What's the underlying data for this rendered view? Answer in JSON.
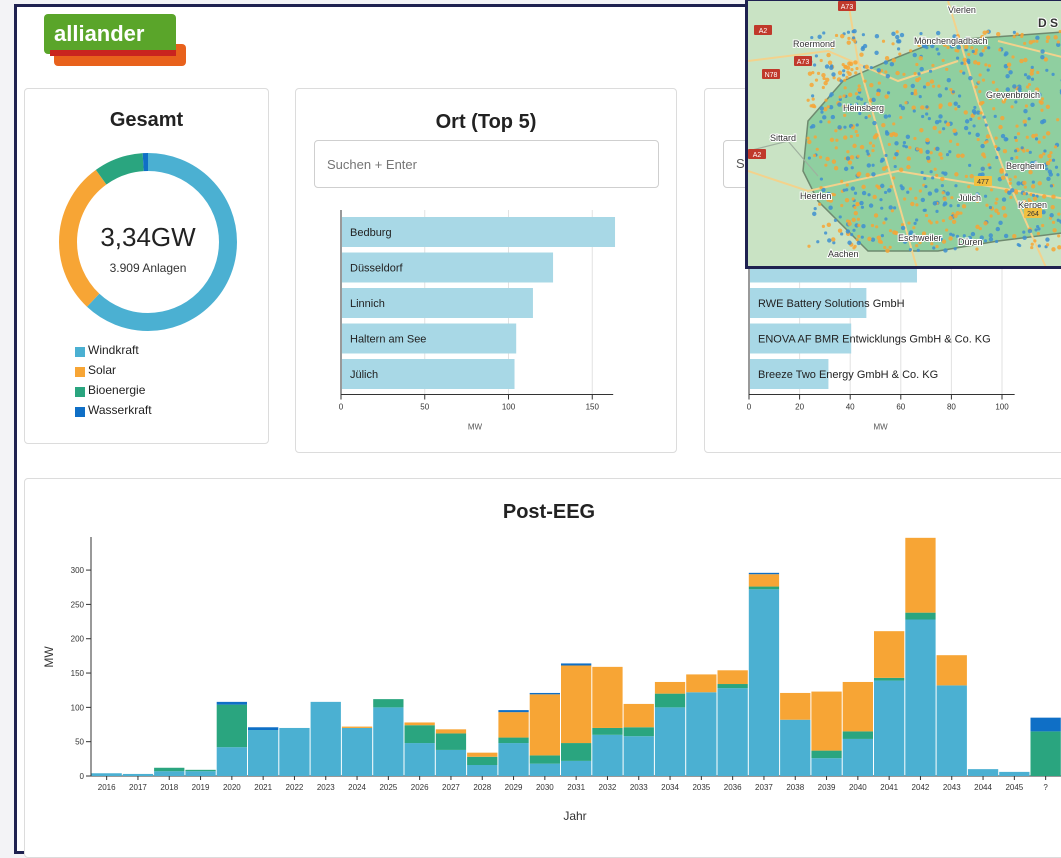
{
  "brand": {
    "logo_text": "alliander"
  },
  "gesamt": {
    "title": "Gesamt",
    "total": "3,34GW",
    "count": "3.909 Anlagen",
    "donut_shares": [
      {
        "name": "Windkraft",
        "value": 0.62,
        "color": "#4bb0d2"
      },
      {
        "name": "Solar",
        "value": 0.28,
        "color": "#f7a535"
      },
      {
        "name": "Bioenergie",
        "value": 0.09,
        "color": "#2aa57f"
      },
      {
        "name": "Wasserkraft",
        "value": 0.01,
        "color": "#0f6fc6"
      }
    ],
    "legend": [
      {
        "label": "Windkraft",
        "color": "#4bb0d2"
      },
      {
        "label": "Solar",
        "color": "#f7a535"
      },
      {
        "label": "Bioenergie",
        "color": "#2aa57f"
      },
      {
        "label": "Wasserkraft",
        "color": "#0f6fc6"
      }
    ]
  },
  "ort": {
    "title": "Ort (Top 5)",
    "search_placeholder": "Suchen + Enter",
    "xlabel": "MW",
    "ticks": [
      "0",
      "50",
      "100",
      "150"
    ],
    "bars": [
      {
        "label": "Bedburg",
        "value": 163
      },
      {
        "label": "Düsseldorf",
        "value": 126
      },
      {
        "label": "Linnich",
        "value": 114
      },
      {
        "label": "Haltern am See",
        "value": 104
      },
      {
        "label": "Jülich",
        "value": 103
      }
    ]
  },
  "betreiber": {
    "search_placeholder_partial": "Su",
    "xlabel": "MW",
    "ticks": [
      "0",
      "20",
      "40",
      "60",
      "80",
      "100"
    ],
    "bars": [
      {
        "label": "",
        "value": 66
      },
      {
        "label": "RWE Battery Solutions GmbH",
        "value": 46
      },
      {
        "label": "ENOVA AF BMR Entwicklungs GmbH & Co. KG",
        "value": 40
      },
      {
        "label": "Breeze Two Energy GmbH & Co. KG",
        "value": 31
      }
    ]
  },
  "map": {
    "labels": [
      "Roermond",
      "Mönchengladbach",
      "D S",
      "Grevenbroich",
      "Heinsberg",
      "Sittard",
      "Heerlen",
      "Jülich",
      "Bergheim",
      "Eschweiler",
      "Düren",
      "Aachen",
      "Kerpen",
      "Vierlen"
    ],
    "road_labels": [
      "A73",
      "A2",
      "N78",
      "A73",
      "A2",
      "477",
      "264"
    ],
    "colors": {
      "land": "#c9e3c4",
      "region": "#8fcfa0",
      "dot_orange": "#f7a535",
      "dot_blue": "#3e8fd0"
    }
  },
  "post_eeg": {
    "title": "Post-EEG",
    "xlabel": "Jahr",
    "ylabel": "MW",
    "yticks": [
      "0",
      "50",
      "100",
      "150",
      "200",
      "250",
      "300"
    ]
  },
  "chart_data": {
    "type": "bar",
    "title": "Post-EEG",
    "xlabel": "Jahr",
    "ylabel": "MW",
    "ylim": [
      0,
      350
    ],
    "stacked": true,
    "categories": [
      "2016",
      "2017",
      "2018",
      "2019",
      "2020",
      "2021",
      "2022",
      "2023",
      "2024",
      "2025",
      "2026",
      "2027",
      "2028",
      "2029",
      "2030",
      "2031",
      "2032",
      "2033",
      "2034",
      "2035",
      "2036",
      "2037",
      "2038",
      "2039",
      "2040",
      "2041",
      "2042",
      "2043",
      "2044",
      "2045",
      "?"
    ],
    "series": [
      {
        "name": "Windkraft",
        "color": "#4bb0d2",
        "values": [
          4,
          3,
          7,
          7,
          42,
          67,
          70,
          108,
          70,
          100,
          48,
          38,
          16,
          48,
          18,
          22,
          60,
          58,
          100,
          122,
          128,
          272,
          82,
          26,
          54,
          139,
          228,
          132,
          10,
          6,
          0
        ]
      },
      {
        "name": "Bioenergie",
        "color": "#2aa57f",
        "values": [
          0,
          0,
          5,
          2,
          62,
          0,
          0,
          0,
          0,
          12,
          26,
          24,
          12,
          8,
          12,
          26,
          10,
          13,
          20,
          0,
          6,
          4,
          0,
          11,
          11,
          4,
          10,
          0,
          0,
          0,
          65
        ]
      },
      {
        "name": "Solar",
        "color": "#f7a535",
        "values": [
          0,
          0,
          0,
          0,
          0,
          0,
          0,
          0,
          2,
          0,
          4,
          6,
          6,
          37,
          89,
          113,
          89,
          34,
          17,
          26,
          20,
          18,
          39,
          86,
          72,
          68,
          109,
          44,
          0,
          0,
          0
        ]
      },
      {
        "name": "Wasserkraft",
        "color": "#0f6fc6",
        "values": [
          0,
          0,
          0,
          0,
          4,
          4,
          0,
          0,
          0,
          0,
          0,
          0,
          0,
          3,
          2,
          3,
          0,
          0,
          0,
          0,
          0,
          2,
          0,
          0,
          0,
          0,
          0,
          0,
          0,
          0,
          20
        ]
      }
    ]
  }
}
